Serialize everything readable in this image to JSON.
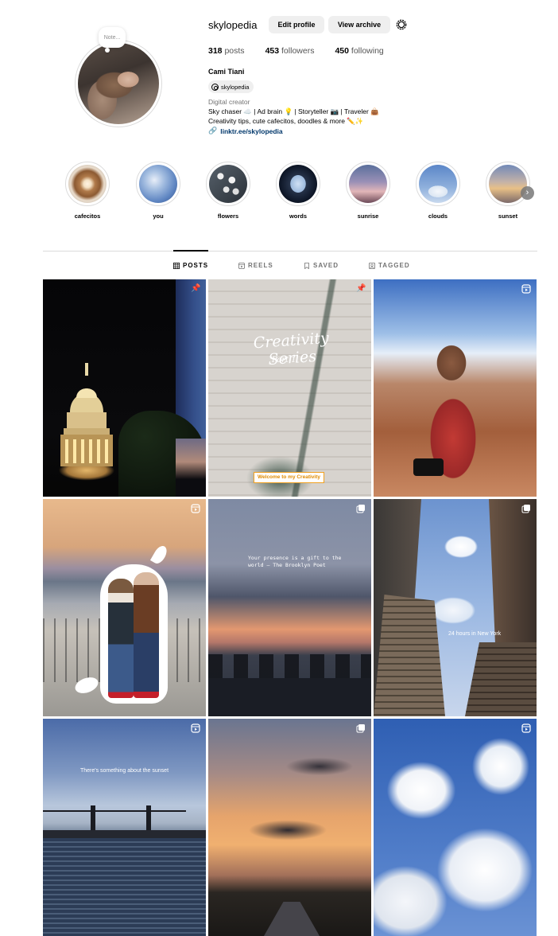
{
  "profile": {
    "username": "skylopedia",
    "note_placeholder": "Note...",
    "edit_profile_label": "Edit profile",
    "view_archive_label": "View archive",
    "stats": {
      "posts_count": "318",
      "posts_label": "posts",
      "followers_count": "453",
      "followers_label": "followers",
      "following_count": "450",
      "following_label": "following"
    },
    "full_name": "Cami Tiani",
    "threads_handle": "skylopedia",
    "category": "Digital creator",
    "bio_line1": "Sky chaser ☁️ | Ad brain 💡 | Storyteller 📷 | Traveler 👜",
    "bio_line2": "Creativity tips, cute cafecitos, doodles & more ✏️✨",
    "link": "linktr.ee/skylopedia"
  },
  "highlights": [
    {
      "label": "cafecitos"
    },
    {
      "label": "you"
    },
    {
      "label": "flowers"
    },
    {
      "label": "words"
    },
    {
      "label": "sunrise"
    },
    {
      "label": "clouds"
    },
    {
      "label": "sunset"
    }
  ],
  "tabs": {
    "posts": "POSTS",
    "reels": "REELS",
    "saved": "SAVED",
    "tagged": "TAGGED",
    "active": "posts"
  },
  "posts": [
    {
      "badge_icon": "pin-icon"
    },
    {
      "badge_icon": "pin-icon",
      "overlay_title": "Creativity Series",
      "overlay_sub": "Part 1",
      "caption_tag": "Welcome to my Creativity"
    },
    {
      "badge_icon": "reel-icon"
    },
    {
      "badge_icon": "reel-icon"
    },
    {
      "badge_icon": "carousel-icon",
      "overlay_text": "Your presence is a gift to the world — The Brooklyn Poet"
    },
    {
      "badge_icon": "carousel-icon",
      "overlay_text": "24 hours in New York"
    },
    {
      "badge_icon": "reel-icon",
      "overlay_text": "There's something about the sunset"
    },
    {
      "badge_icon": "carousel-icon"
    },
    {
      "badge_icon": "reel-icon"
    }
  ],
  "colors": {
    "link": "#00376b",
    "button_bg": "#efefef",
    "muted_text": "#737373",
    "divider": "#dbdbdb"
  }
}
